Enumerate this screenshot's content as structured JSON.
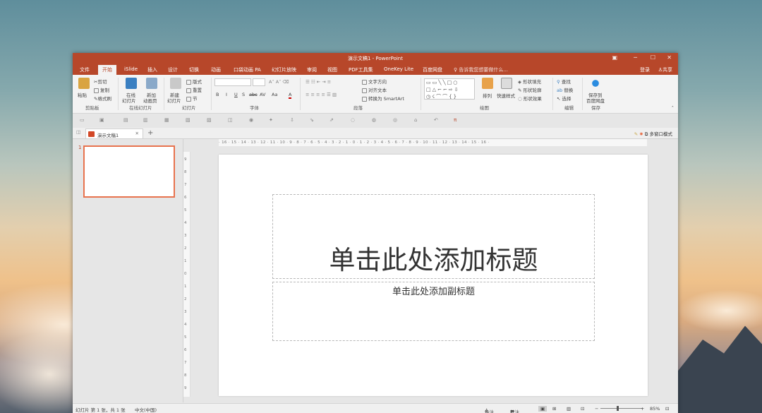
{
  "window": {
    "title": "演示文稿1 - PowerPoint"
  },
  "menu": {
    "tabs": [
      "文件",
      "开始",
      "iSlide",
      "插入",
      "设计",
      "切换",
      "动画",
      "口袋动画 PA",
      "幻灯片放映",
      "审阅",
      "视图",
      "PDF工具集",
      "OneKey Lite",
      "百度网盘"
    ],
    "active_index": 1,
    "tell_me": "告诉我您想要做什么...",
    "login": "登录",
    "share": "共享"
  },
  "ribbon": {
    "clipboard": {
      "paste": "粘贴",
      "cut": "剪切",
      "copy": "复制",
      "format_painter": "格式刷",
      "group": "剪贴板"
    },
    "online_slides": {
      "online": "在线",
      "online2": "幻灯片",
      "add_anim": "新加",
      "add_anim2": "动画页",
      "group": "在线幻灯片"
    },
    "slides": {
      "new_slide": "新建",
      "new_slide2": "幻灯片",
      "layout": "版式",
      "reset": "重置",
      "section": "节",
      "group": "幻灯片"
    },
    "font": {
      "group": "字体",
      "bold": "B",
      "italic": "I",
      "underline": "U",
      "shadow": "S",
      "strike": "abc",
      "spacing": "AV",
      "case": "Aa",
      "color": "A"
    },
    "paragraph": {
      "text_dir": "文字方向",
      "align_text": "对齐文本",
      "smartart": "转换为 SmartArt",
      "group": "段落"
    },
    "drawing": {
      "arrange": "排列",
      "quick_styles": "快速样式",
      "fill": "形状填充",
      "outline": "形状轮廓",
      "effects": "形状效果",
      "group": "绘图"
    },
    "editing": {
      "find": "查找",
      "replace": "替换",
      "select": "选择",
      "group": "编辑"
    },
    "save": {
      "save_to": "保存到",
      "baidu": "百度网盘",
      "group": "保存"
    }
  },
  "doc_tab": {
    "name": "演示文稿1",
    "close": "✕",
    "new": "+",
    "multi_window": "多窗口模式"
  },
  "ruler": {
    "horizontal": "· 16 · 15 · 14 · 13 · 12 · 11 · 10 · 9 · 8 · 7 · 6 · 5 · 4 · 3 · 2 · 1 · 0 · 1 · 2 · 3 · 4 · 5 · 6 · 7 · 8 · 9 · 10 · 11 · 12 · 13 · 14 · 15 · 16 ·",
    "vertical": [
      "9",
      "8",
      "7",
      "6",
      "5",
      "4",
      "3",
      "2",
      "1",
      "0",
      "1",
      "2",
      "3",
      "4",
      "5",
      "6",
      "7",
      "8",
      "9"
    ]
  },
  "thumbnail": {
    "number": "1"
  },
  "slide": {
    "title_placeholder": "单击此处添加标题",
    "subtitle_placeholder": "单击此处添加副标题"
  },
  "status": {
    "slide_info": "幻灯片 第 1 张，共 1 张",
    "language": "中文(中国)",
    "notes": "备注",
    "comments": "批注",
    "zoom": "85%"
  },
  "colors": {
    "accent": "#b7472a",
    "thumb_border": "#e8734e"
  }
}
